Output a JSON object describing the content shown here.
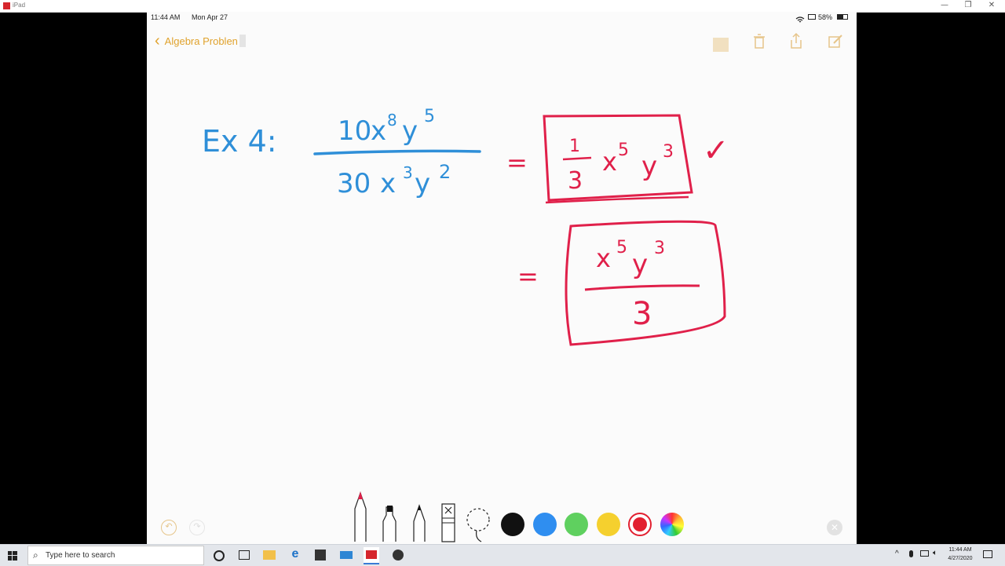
{
  "window": {
    "title": "iPad",
    "controls": {
      "minimize": "—",
      "restore": "❐",
      "close": "✕"
    }
  },
  "ipad": {
    "status_time": "11:44 AM",
    "status_date": "Mon Apr 27",
    "battery": "58%",
    "nav_back_label": "Algebra Problen",
    "icons": [
      "chevron-left-icon",
      "trash-icon",
      "share-icon",
      "compose-icon",
      "undo-icon",
      "redo-icon",
      "close-icon"
    ],
    "accent_color": "#e0a22c"
  },
  "note": {
    "example_label": "Ex 4:",
    "numerator": {
      "coef": "10",
      "x": "x",
      "x_exp": "8",
      "y": "y",
      "y_exp": "5"
    },
    "denominator": {
      "coef": "30",
      "x": "x",
      "x_exp": "3",
      "y": "y",
      "y_exp": "2"
    },
    "equals_1": "=",
    "answer_1": {
      "frac_num": "1",
      "frac_den": "3",
      "x": "x",
      "x_exp": "5",
      "y": "y",
      "y_exp": "3"
    },
    "checkmark": "✓",
    "equals_2": "=",
    "answer_2": {
      "x": "x",
      "x_exp": "5",
      "y": "y",
      "y_exp": "3",
      "den": "3"
    },
    "ink_colors": {
      "blue": "#2f8fd8",
      "red": "#e0204a"
    }
  },
  "palette": {
    "tools": [
      "pen-tool",
      "marker-tool",
      "pencil-tool",
      "eraser-tool",
      "lasso-tool"
    ],
    "colors": [
      "#111111",
      "#2f8ef0",
      "#5fd05f",
      "#f5d02e",
      "#e22030"
    ],
    "selected_color": "#e22030"
  },
  "taskbar": {
    "search_placeholder": "Type here to search",
    "clock_time": "11:44 AM",
    "clock_date": "4/27/2020"
  }
}
